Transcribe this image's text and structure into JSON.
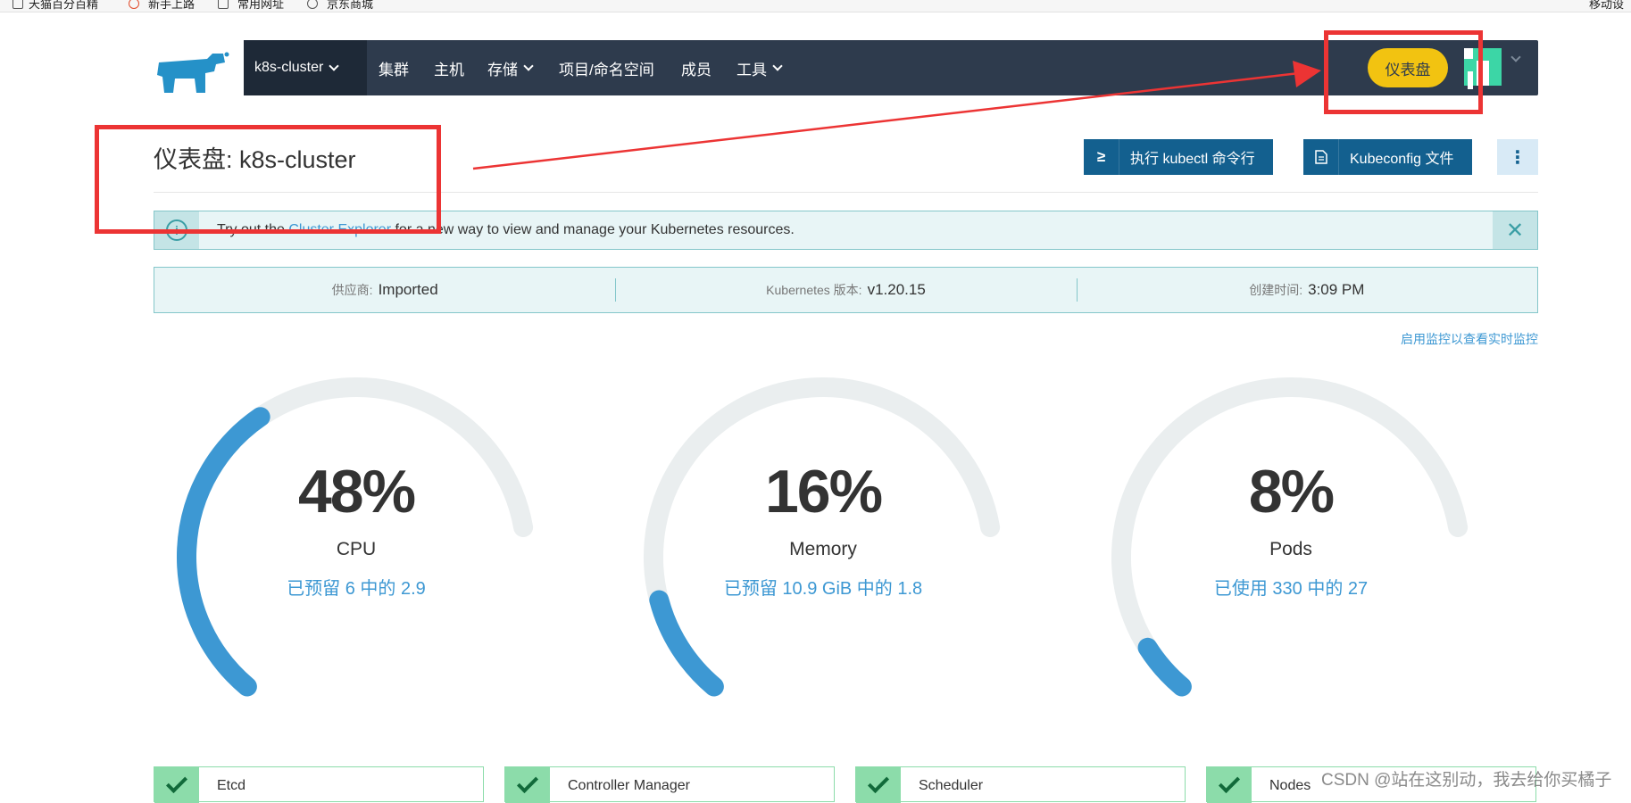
{
  "bookmarks": [
    "天猫百分百精",
    "新手上路",
    "常用网址",
    "京东商城",
    "移动设"
  ],
  "nav": {
    "cluster": "k8s-cluster",
    "items": [
      "集群",
      "主机",
      "存储",
      "项目/命名空间",
      "成员",
      "工具"
    ],
    "dashboard_button": "仪表盘"
  },
  "header": {
    "title": "仪表盘: k8s-cluster",
    "kubectl_button": "执行 kubectl 命令行",
    "kubectl_icon": "≥",
    "kubeconfig_button": "Kubeconfig 文件",
    "more_icon": "⋮"
  },
  "banner": {
    "prefix": "Try out the ",
    "link": "Cluster Explorer",
    "suffix": " for a new way to view and manage your Kubernetes resources.",
    "info_icon": "i",
    "close_icon": "✕"
  },
  "info": {
    "provider_label": "供应商:",
    "provider_value": "Imported",
    "k8s_label": "Kubernetes 版本:",
    "k8s_value": "v1.20.15",
    "created_label": "创建时间:",
    "created_value": "3:09 PM"
  },
  "monitoring_link": "启用监控以查看实时监控",
  "gauges": [
    {
      "percent": "48%",
      "value": 0.48,
      "name": "CPU",
      "detail": "已预留 6 中的 2.9"
    },
    {
      "percent": "16%",
      "value": 0.16,
      "name": "Memory",
      "detail": "已预留 10.9 GiB 中的 1.8"
    },
    {
      "percent": "8%",
      "value": 0.08,
      "name": "Pods",
      "detail": "已使用 330 中的 27"
    }
  ],
  "components": [
    "Etcd",
    "Controller Manager",
    "Scheduler",
    "Nodes"
  ],
  "watermark": "CSDN @站在这别动，我去给你买橘子",
  "colors": {
    "nav_bg": "#2e3b4d",
    "accent_yellow": "#f2c311",
    "primary_blue": "#13608f",
    "gauge_fill": "#3d98d3",
    "gauge_track": "#eaeeef",
    "annotation_red": "#ec3434"
  }
}
